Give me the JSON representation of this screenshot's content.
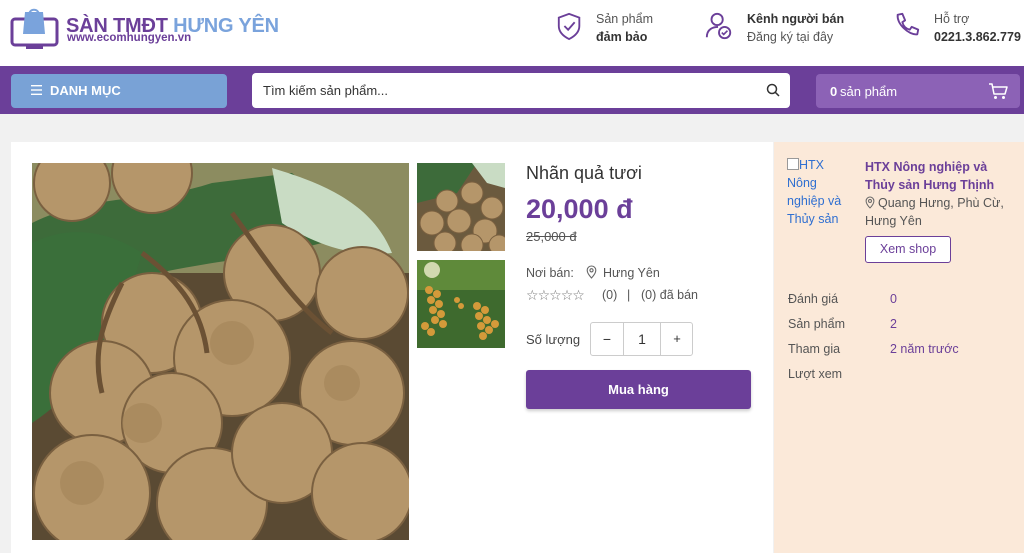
{
  "header": {
    "logo": {
      "title_a": "SÀN TMĐT",
      "title_b": "HƯNG YÊN",
      "url": "www.ecomhungyen.vn"
    },
    "guarantee": {
      "line1": "Sản phẩm",
      "line2": "đảm bảo",
      "icon": "shield-check-icon"
    },
    "seller_channel": {
      "line1": "Kênh người bán",
      "line2": "Đăng ký tại đây",
      "icon": "user-check-icon"
    },
    "support": {
      "line1": "Hỗ trợ",
      "line2": "0221.3.862.779",
      "icon": "phone-icon"
    }
  },
  "navbar": {
    "category_label": "DANH MỤC",
    "search_placeholder": "Tìm kiếm sản phẩm...",
    "cart_count": "0",
    "cart_label": "sản phẩm"
  },
  "product": {
    "name": "Nhãn quả tươi",
    "price": "20,000 đ",
    "old_price": "25,000 đ",
    "seller_label": "Nơi bán:",
    "seller_location": "Hưng Yên",
    "rating_count": "(0)",
    "separator": "|",
    "sold": "(0) đã bán",
    "quantity_label": "Số lượng",
    "quantity": "1",
    "minus": "−",
    "plus": "+",
    "buy_label": "Mua hàng"
  },
  "shop": {
    "image_alt": "HTX Nông nghiệp và Thủy sản",
    "name": "HTX Nông nghiệp và Thủy sản Hưng Thịnh",
    "address": "Quang Hưng, Phù Cừ, Hưng Yên",
    "view_label": "Xem shop",
    "stats": [
      {
        "label": "Đánh giá",
        "value": "0"
      },
      {
        "label": "Sản phẩm",
        "value": "2"
      },
      {
        "label": "Tham gia",
        "value": "2 năm trước"
      },
      {
        "label": "Lượt xem",
        "value": ""
      }
    ]
  },
  "colors": {
    "primary": "#6b3f99",
    "accent": "#79a2d6",
    "shop_bg": "#fbe9d9"
  }
}
